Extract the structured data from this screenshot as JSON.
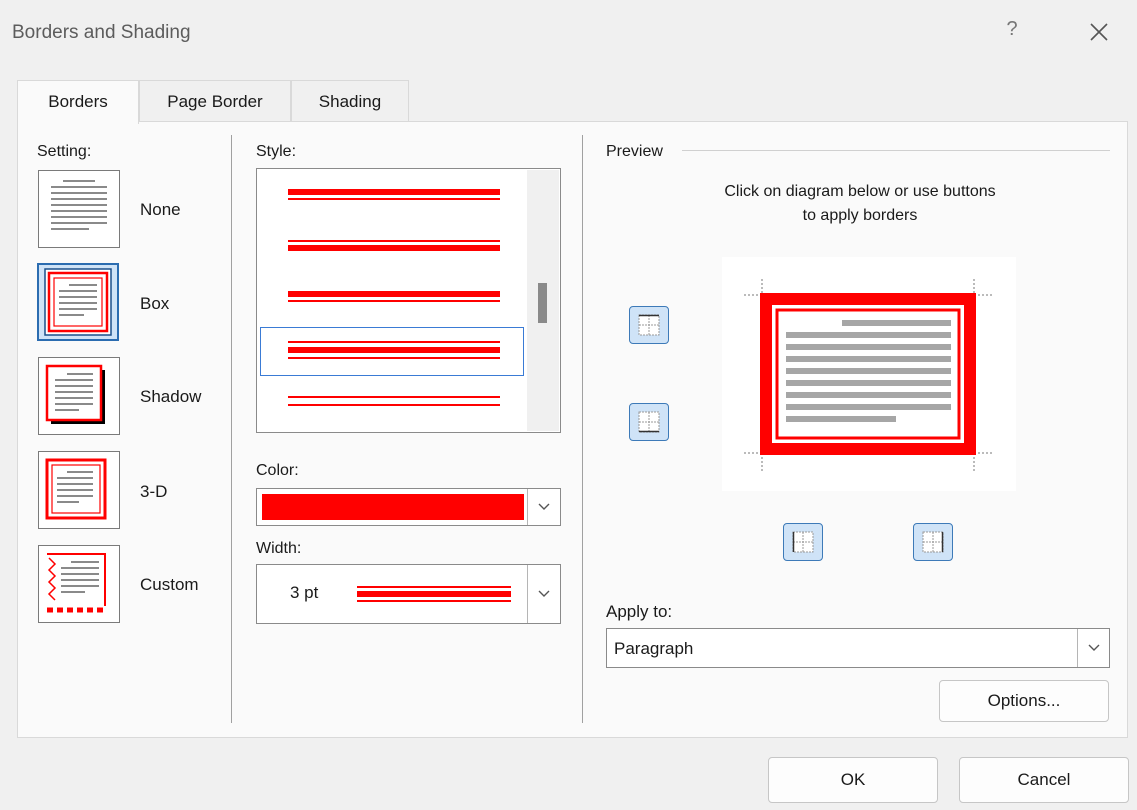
{
  "window": {
    "title": "Borders and Shading",
    "help_label": "?",
    "close_label": "✕"
  },
  "tabs": [
    {
      "label": "Borders",
      "active": true
    },
    {
      "label": "Page Border",
      "active": false
    },
    {
      "label": "Shading",
      "active": false
    }
  ],
  "setting": {
    "label": "Setting:",
    "options": [
      {
        "label": "None",
        "selected": false
      },
      {
        "label": "Box",
        "selected": true
      },
      {
        "label": "Shadow",
        "selected": false
      },
      {
        "label": "3-D",
        "selected": false
      },
      {
        "label": "Custom",
        "selected": false
      }
    ]
  },
  "style": {
    "label": "Style:",
    "selected_index": 3
  },
  "color": {
    "label": "Color:",
    "value_hex": "#ff0000"
  },
  "width": {
    "label": "Width:",
    "value": "3 pt"
  },
  "preview": {
    "label": "Preview",
    "instruction_line1": "Click on diagram below or use buttons",
    "instruction_line2": "to apply borders"
  },
  "apply_to": {
    "label": "Apply to:",
    "value": "Paragraph"
  },
  "buttons": {
    "options_label": "Options...",
    "ok_label": "OK",
    "cancel_label": "Cancel"
  },
  "colors": {
    "accent_red": "#ff0000",
    "selection_blue": "#cfe3f7",
    "border_blue": "#3a7bd5"
  }
}
